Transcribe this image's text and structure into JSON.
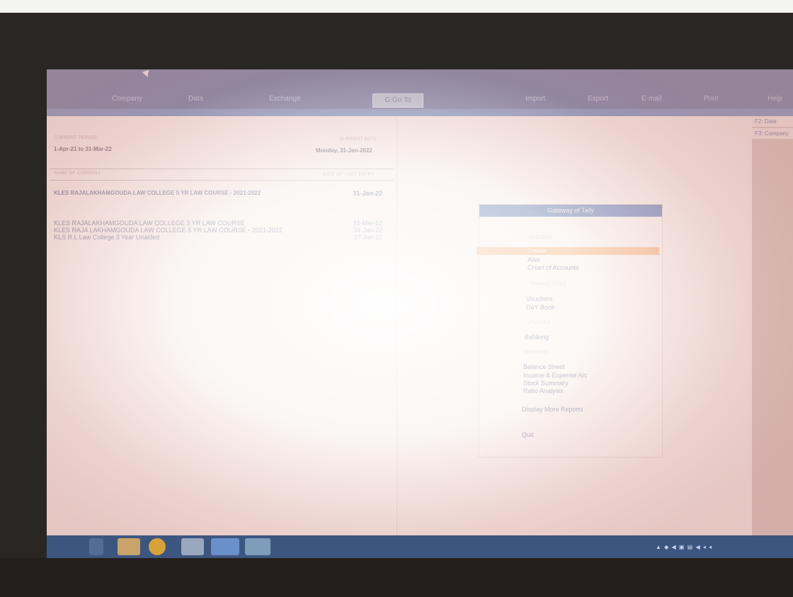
{
  "menubar": {
    "items": [
      "Company",
      "Data",
      "Exchange",
      "Import",
      "Export",
      "E-mail",
      "Print",
      "Help"
    ],
    "goto_label": "G:Go To"
  },
  "company_info": {
    "period_label": "CURRENT PERIOD",
    "period_value": "1-Apr-21 to 31-Mar-22",
    "date_label": "CURRENT DATE",
    "date_value": "Monday, 31-Jan-2022",
    "name_header": "NAME OF COMPANY",
    "last_entry_header": "DATE OF LAST ENTRY",
    "active_company": {
      "name": "KLES RAJALAKHAMGOUDA LAW COLLEGE 5 YR LAW COURSE - 2021-2022",
      "date": "31-Jan-22"
    },
    "companies": [
      {
        "name": "KLES RAJALAKHAMGOUDA LAW COLLEGE 3 YR LAW COURSE",
        "date": "31-Mar-12"
      },
      {
        "name": "KLES RAJA LAKHAMGOUDA LAW COLLEGE 5 YR LAW COURSE - 2021-2022",
        "date": "31-Jan-22"
      },
      {
        "name": "KLS R.L Law College 3 Year Unaided",
        "date": "27-Jan-22"
      }
    ]
  },
  "fkeys": [
    "F2: Date",
    "F3: Company"
  ],
  "gateway": {
    "title": "Gateway of Tally",
    "masters_head": "MASTERS",
    "create": "Create",
    "alter": "Alter",
    "chart": "CHart of Accounts",
    "transactions_head": "TRANSACTIONS",
    "vouchers": "Vouchers",
    "daybook": "DaY Book",
    "utilities_head": "UTILITIES",
    "banking": "BaNking",
    "reports_head": "REPORTS",
    "balance_sheet": "Balance Sheet",
    "income_expense": "Income & Expense A/c",
    "stock_summary": "Stock Summary",
    "ratio_analysis": "Ratio Analysis",
    "display_more": "Display More Reports",
    "quit": "Quit"
  },
  "colors": {
    "menubar": "#2b4a88",
    "gateway_title": "#2f57a3",
    "selection": "#f3a05b"
  }
}
